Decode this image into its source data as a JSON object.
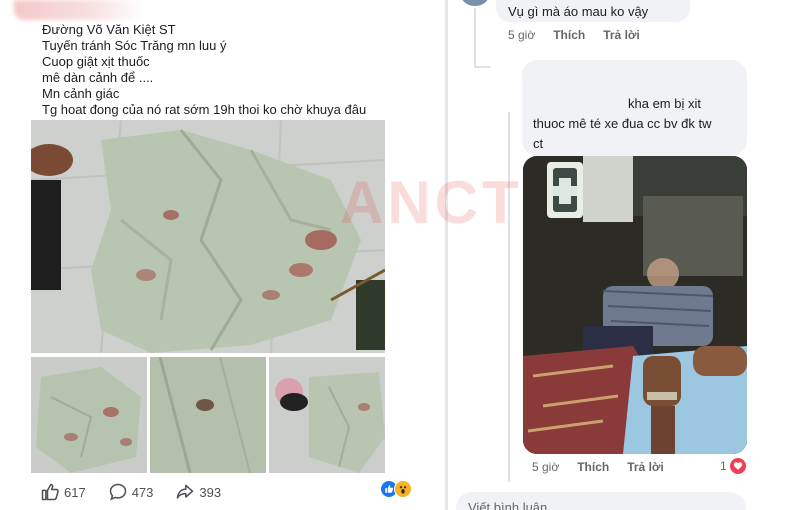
{
  "post": {
    "lines": [
      "Đường Võ Văn Kiệt ST",
      "Tuyến tránh Sóc Trăng mn luu ý",
      "Cuop giật xịt thuốc",
      "mê dàn cảnh để ....",
      "Mn cảnh giác",
      "Tg hoat đong của nó rat sớm 19h thoi ko chờ khuya đâu"
    ],
    "images": [
      "bloodstained-shirt-main",
      "bloodstained-shirt-1",
      "bloodstained-shirt-2",
      "bloodstained-shirt-3"
    ],
    "stats": {
      "likes": "617",
      "comments": "473",
      "shares": "393"
    },
    "reaction_icons": [
      "like-icon",
      "wow-icon"
    ]
  },
  "comments": [
    {
      "text": "Vụ gì mà áo mau ko vậy",
      "time": "5 giờ",
      "like_label": "Thích",
      "reply_label": "Trả lời"
    },
    {
      "lines": [
        "kha em bị xit",
        "thuoc mê té xe đua cc bv đk tw",
        "ct"
      ],
      "image": "ambulance-patient-photo",
      "time": "5 giờ",
      "like_label": "Thích",
      "reply_label": "Trả lời",
      "reaction_count": "1",
      "reaction_icon": "heart-icon"
    }
  ],
  "composer": {
    "placeholder": "Viết bình luận"
  },
  "watermark": "ANCT",
  "colors": {
    "facebook_blue": "#1877f2",
    "heart_red": "#f33e58",
    "bubble_gray": "#f0f2f5",
    "meta_gray": "#65676b"
  }
}
